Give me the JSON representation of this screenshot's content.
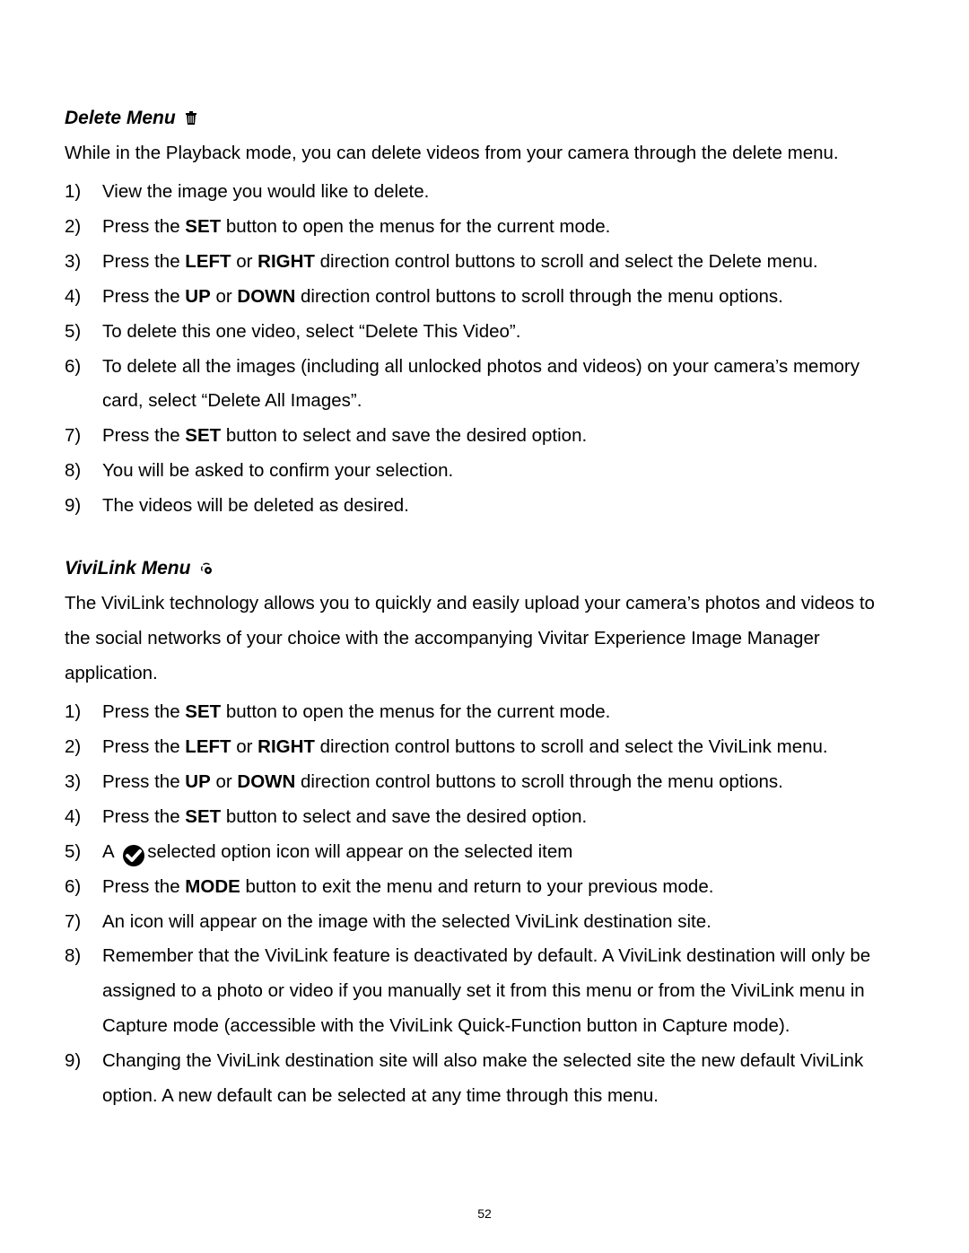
{
  "page_number": "52",
  "sections": {
    "delete": {
      "title": "Delete Menu",
      "intro": "While in the Playback mode, you can delete videos from your camera through the delete menu.",
      "steps": {
        "s1": {
          "m": "1)",
          "a": "View the image you would like to delete."
        },
        "s2": {
          "m": "2)",
          "a": "Press the ",
          "b": "SET",
          "c": " button to open the menus for the current mode."
        },
        "s3": {
          "m": "3)",
          "a": "Press the ",
          "b": "LEFT",
          "c": " or ",
          "d": "RIGHT",
          "e": " direction control buttons to scroll and select the Delete menu."
        },
        "s4": {
          "m": "4)",
          "a": "Press the ",
          "b": "UP",
          "c": " or ",
          "d": "DOWN",
          "e": " direction control buttons to scroll through the menu options."
        },
        "s5": {
          "m": "5)",
          "a": "To delete this one video, select “Delete This Video”."
        },
        "s6": {
          "m": "6)",
          "a": "To delete all the images (including all unlocked photos and videos) on your camera’s memory card, select “Delete All Images”."
        },
        "s7": {
          "m": "7)",
          "a": "Press the ",
          "b": "SET",
          "c": " button to select and save the desired option."
        },
        "s8": {
          "m": "8)",
          "a": "You will be asked to confirm your selection."
        },
        "s9": {
          "m": "9)",
          "a": "The videos will be deleted as desired."
        }
      }
    },
    "vivilink": {
      "title": "ViviLink Menu",
      "intro": "The ViviLink technology allows you to quickly and easily upload your camera’s photos and videos to the social networks of your choice with the accompanying Vivitar Experience Image Manager application.",
      "steps": {
        "s1": {
          "m": "1)",
          "a": "Press the ",
          "b": "SET",
          "c": " button to open the menus for the current mode."
        },
        "s2": {
          "m": "2)",
          "a": "Press the ",
          "b": "LEFT",
          "c": " or ",
          "d": "RIGHT",
          "e": " direction control buttons to scroll and select the ViviLink menu."
        },
        "s3": {
          "m": "3)",
          "a": "Press the ",
          "b": "UP",
          "c": " or ",
          "d": "DOWN",
          "e": " direction control buttons to scroll through the menu options."
        },
        "s4": {
          "m": "4)",
          "a": "Press the ",
          "b": "SET",
          "c": " button to select and save the desired option."
        },
        "s5": {
          "m": "5)",
          "a": "A ",
          "c": "selected option icon will appear on the selected item"
        },
        "s6": {
          "m": "6)",
          "a": "Press the ",
          "b": "MODE",
          "c": " button to exit the menu and return to your previous mode."
        },
        "s7": {
          "m": "7)",
          "a": "An icon will appear on the image with the selected ViviLink destination site."
        },
        "s8": {
          "m": "8)",
          "a": "Remember that the ViviLink feature is deactivated by default. A ViviLink destination will only be assigned to a photo or video if you manually set it from this menu or from the ViviLink menu in Capture mode (accessible with the ViviLink Quick-Function button in Capture mode)."
        },
        "s9": {
          "m": "9)",
          "a": "Changing the ViviLink destination site will also make the selected site the new default ViviLink option. A new default can be selected at any time through this menu."
        }
      }
    }
  }
}
